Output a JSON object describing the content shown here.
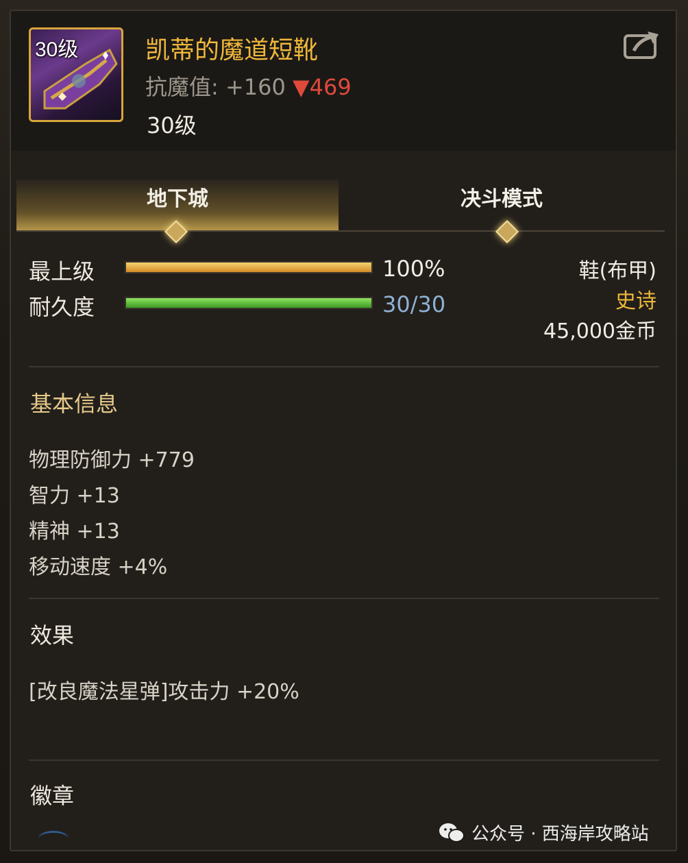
{
  "item": {
    "icon_level": "30级",
    "name": "凯蒂的魔道短靴",
    "resist_label": "抗魔值:",
    "resist_value": "+160",
    "resist_delta": "▼469",
    "level": "30级"
  },
  "tabs": [
    {
      "label": "地下城",
      "active": true
    },
    {
      "label": "决斗模式",
      "active": false
    }
  ],
  "stats": {
    "grade_label": "最上级",
    "grade_percent": "100%",
    "grade_fill": 1.0,
    "durability_label": "耐久度",
    "durability_value": "30/30",
    "durability_fill": 1.0
  },
  "meta": {
    "type": "鞋(布甲)",
    "rarity": "史诗",
    "price": "45,000金币"
  },
  "basic_info": {
    "title": "基本信息",
    "lines": [
      "物理防御力 +779",
      "智力 +13",
      "精神 +13",
      "移动速度 +4%"
    ]
  },
  "effect": {
    "title": "效果",
    "lines": [
      "[改良魔法星弹]攻击力 +20%"
    ]
  },
  "badge": {
    "title": "徽章"
  },
  "watermark": {
    "text": "公众号 · 西海岸攻略站"
  },
  "colors": {
    "name": "#f0b83a",
    "rarity": "#f0b83a",
    "delta": "#e04a3c",
    "durability_value": "#8fb1d4"
  }
}
